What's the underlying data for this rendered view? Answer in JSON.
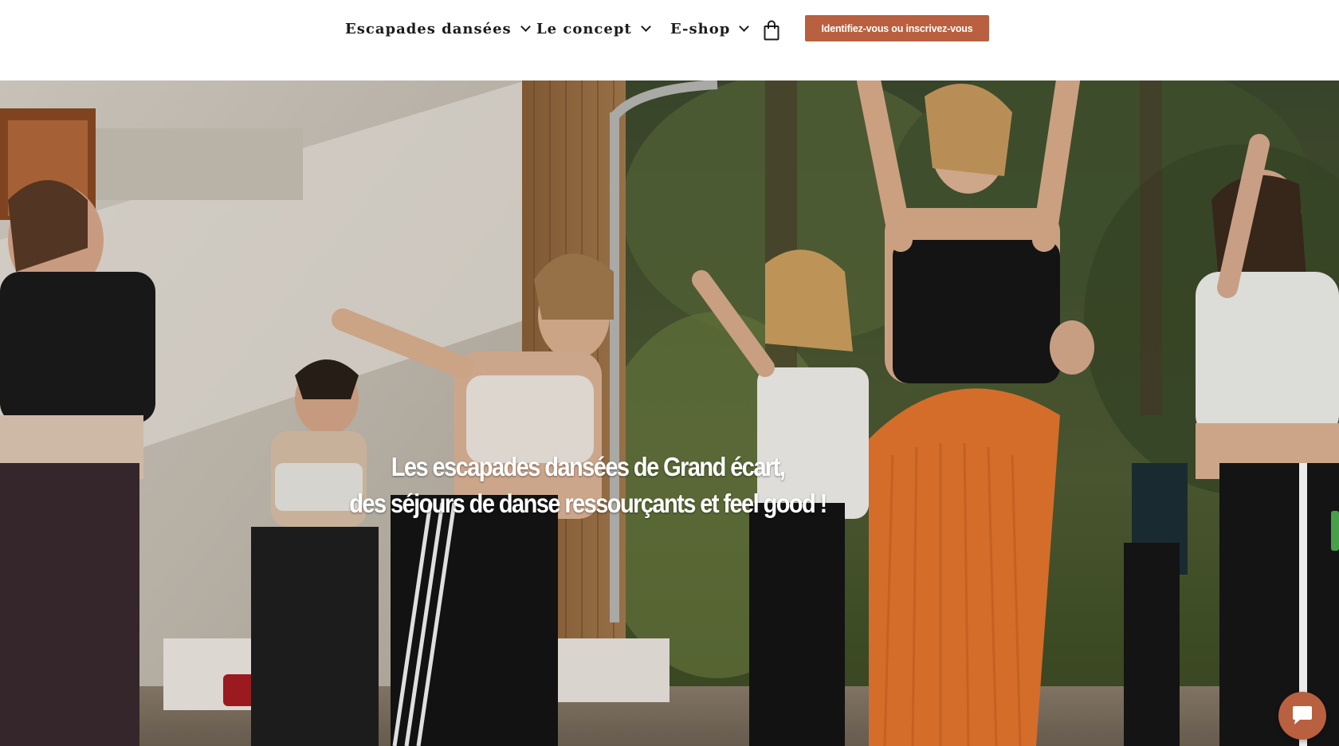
{
  "header": {
    "nav": [
      {
        "label": "Escapades dansées"
      },
      {
        "label": "Le concept"
      },
      {
        "label": "E-shop"
      }
    ],
    "cart_icon": "shopping-bag-icon",
    "login_label": "Identifiez-vous ou inscrivez-vous"
  },
  "hero": {
    "title_line1": "Les escapades dansées de Grand écart,",
    "title_line2": "des séjours de danse ressourçants et feel good !"
  },
  "chat": {
    "icon": "chat-bubble-icon"
  },
  "colors": {
    "accent": "#b8603f",
    "nav_text": "#1c1c1c",
    "header_bg": "#ffffff"
  }
}
